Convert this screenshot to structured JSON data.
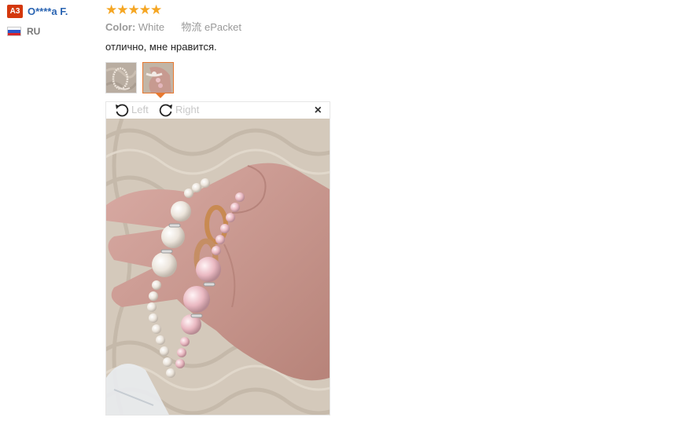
{
  "reviewer": {
    "badge": "A3",
    "name": "O****a F.",
    "country": "RU",
    "flag_colors": [
      "#ffffff",
      "#2c56c9",
      "#d7262b"
    ]
  },
  "review": {
    "rating": 5,
    "rating_stars": "★★★★★",
    "color_label": "Color:",
    "color_value": "White",
    "shipping_label": "物流",
    "shipping_value": "ePacket",
    "text": "отлично, мне нравится."
  },
  "images": {
    "count": 2,
    "selected_index": 2
  },
  "viewer": {
    "rotate_left_label": "Left",
    "rotate_right_label": "Right",
    "close_symbol": "×"
  },
  "colors": {
    "accent": "#e8782f",
    "badge": "#d4380d",
    "link": "#2a64b2",
    "stars": "#f5a623"
  }
}
